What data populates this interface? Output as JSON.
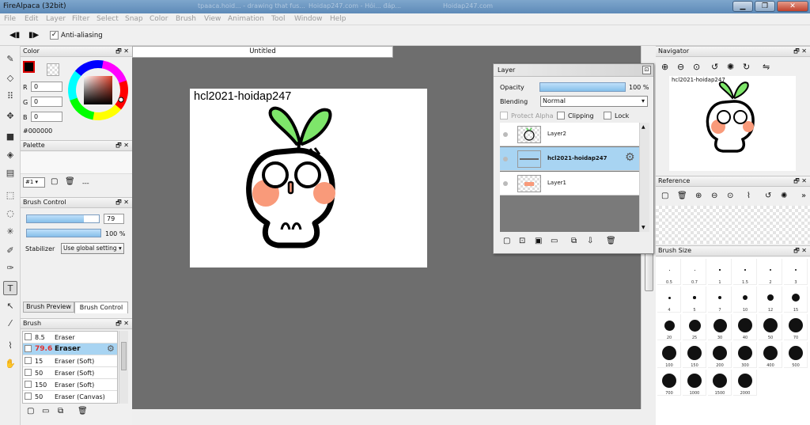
{
  "app": {
    "title": "FireAlpaca (32bit)",
    "ghost_tabs": [
      "tpaaca.hoid... - drawing that fus...",
      "Hoidap247.com - Hỏi... đáp...",
      "Hoidap247.com"
    ]
  },
  "menu": [
    "File",
    "Edit",
    "Layer",
    "Filter",
    "Select",
    "Snap",
    "Color",
    "Brush",
    "View",
    "Animation",
    "Tool",
    "Window",
    "Help"
  ],
  "toolbar": {
    "antialias_label": "Anti-aliasing",
    "antialias_checked": "✓"
  },
  "document": {
    "tab_title": "Untitled",
    "canvas_text": "hcl2021-hoidap247"
  },
  "color_panel": {
    "title": "Color",
    "r_label": "R",
    "r_value": "0",
    "g_label": "G",
    "g_value": "0",
    "b_label": "B",
    "b_value": "0",
    "hex": "#000000"
  },
  "palette_panel": {
    "title": "Palette",
    "selector": "#1 ▾",
    "placeholder": "---"
  },
  "brush_control": {
    "title": "Brush Control",
    "size_value": "79",
    "size_fill": 0.79,
    "opacity_value": "100 %",
    "opacity_fill": 1.0,
    "stabilizer_label": "Stabilizer",
    "stabilizer_value": "Use global setting ▾",
    "tab_preview": "Brush Preview",
    "tab_control": "Brush Control"
  },
  "brush_panel": {
    "title": "Brush",
    "items": [
      {
        "size": "8.5",
        "name": "Eraser"
      },
      {
        "size": "79.6",
        "name": "Eraser"
      },
      {
        "size": "15",
        "name": "Eraser (Soft)"
      },
      {
        "size": "50",
        "name": "Eraser (Soft)"
      },
      {
        "size": "150",
        "name": "Eraser (Soft)"
      },
      {
        "size": "50",
        "name": "Eraser (Canvas)"
      }
    ]
  },
  "layer_panel": {
    "title": "Layer",
    "opacity_label": "Opacity",
    "opacity_value": "100 %",
    "blending_label": "Blending",
    "blending_value": "Normal",
    "protect_alpha": "Protect Alpha",
    "clipping": "Clipping",
    "lock": "Lock",
    "layers": [
      {
        "name": "Layer2"
      },
      {
        "name": "hcl2021-hoidap247"
      },
      {
        "name": "Layer1"
      }
    ]
  },
  "navigator": {
    "title": "Navigator",
    "caption": "hcl2021-hoidap247"
  },
  "reference": {
    "title": "Reference"
  },
  "brush_size": {
    "title": "Brush Size",
    "sizes": [
      "0.5",
      "0.7",
      "1",
      "1.5",
      "2",
      "3",
      "4",
      "5",
      "7",
      "10",
      "12",
      "15",
      "20",
      "25",
      "30",
      "40",
      "50",
      "70",
      "100",
      "150",
      "200",
      "300",
      "400",
      "500",
      "700",
      "1000",
      "1500",
      "2000"
    ]
  },
  "colors": {
    "accent": "#a8d4f2",
    "sprout": "#7ee66a",
    "blush": "#f99a7a"
  }
}
